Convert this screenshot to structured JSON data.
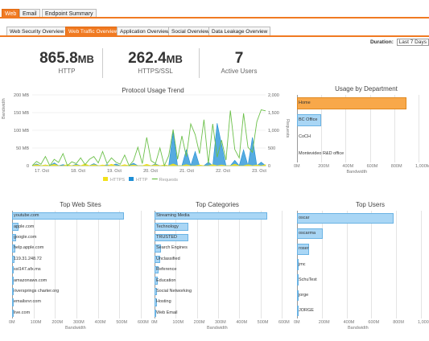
{
  "top_tabs": [
    {
      "label": "Web",
      "active": true
    },
    {
      "label": "Email",
      "active": false
    },
    {
      "label": "Endpoint Summary",
      "active": false
    }
  ],
  "sub_tabs": [
    {
      "label": "Web Security Overview",
      "active": false
    },
    {
      "label": "Web Traffic Overview",
      "active": true
    },
    {
      "label": "Application Overview",
      "active": false
    },
    {
      "label": "Social Overview",
      "active": false
    },
    {
      "label": "Data Leakage Overview",
      "active": false
    }
  ],
  "duration": {
    "label": "Duration:",
    "value": "Last 7 Days"
  },
  "stats": [
    {
      "value": "865.8",
      "unit": "MB",
      "label": "HTTP"
    },
    {
      "value": "262.4",
      "unit": "MB",
      "label": "HTTPS/SSL"
    },
    {
      "value": "7",
      "unit": "",
      "label": "Active Users"
    }
  ],
  "colors": {
    "accent": "#f07a22",
    "https": "#f2e11a",
    "http": "#1e8fd6",
    "requests": "#6cc04a",
    "bar": "#a9d6f5",
    "bar_border": "#6ab3e4",
    "highlight": "#f8a84a"
  },
  "chart_data": [
    {
      "type": "line",
      "title": "Protocol Usage Trend",
      "xlabel": "",
      "ylabel": "Bandwidth",
      "ylabel_right": "Requests",
      "categories": [
        "17. Oct",
        "18. Oct",
        "19. Oct",
        "20. Oct",
        "21. Oct",
        "22. Oct",
        "23. Oct"
      ],
      "ylim": [
        0,
        200
      ],
      "yticks": [
        "0",
        "50 MB",
        "100 MB",
        "150 MB",
        "200 MB"
      ],
      "ylim_right": [
        0,
        2000
      ],
      "yticks_right": [
        "0",
        "500",
        "1,000",
        "1,500",
        "2,000"
      ],
      "legend": [
        "HTTPS",
        "HTTP",
        "Requests"
      ],
      "legend_position": "bottom",
      "series": [
        {
          "name": "HTTPS",
          "values": [
            0,
            3,
            0,
            2,
            0,
            4,
            0,
            0,
            3,
            0,
            2,
            0,
            5,
            0,
            3,
            0,
            2,
            0,
            4,
            0,
            0,
            3,
            0,
            2,
            0,
            0,
            4,
            0,
            3,
            0,
            2,
            0,
            5,
            0,
            0,
            3,
            0,
            0,
            2,
            0,
            0,
            3,
            0,
            2,
            0,
            0,
            4,
            0,
            0,
            3,
            0,
            2,
            0,
            3
          ]
        },
        {
          "name": "HTTP",
          "values": [
            0,
            5,
            0,
            2,
            0,
            8,
            0,
            3,
            0,
            0,
            4,
            0,
            2,
            0,
            6,
            0,
            0,
            3,
            0,
            5,
            0,
            2,
            0,
            7,
            0,
            0,
            3,
            0,
            5,
            0,
            2,
            0,
            95,
            0,
            0,
            45,
            0,
            40,
            0,
            0,
            10,
            0,
            120,
            60,
            0,
            0,
            15,
            0,
            45,
            0,
            80,
            0,
            10,
            0
          ]
        },
        {
          "name": "Requests",
          "values": [
            0,
            120,
            40,
            260,
            0,
            180,
            90,
            340,
            0,
            110,
            60,
            220,
            30,
            180,
            260,
            80,
            400,
            60,
            220,
            100,
            40,
            300,
            0,
            140,
            520,
            60,
            800,
            140,
            60,
            500,
            0,
            280,
            1020,
            180,
            840,
            260,
            1180,
            880,
            340,
            1300,
            60,
            1180,
            240,
            720,
            160,
            1560,
            460,
            220,
            1480,
            520,
            380,
            1240,
            1580,
            1550
          ]
        }
      ]
    },
    {
      "type": "bar",
      "title": "Usage by Department",
      "orientation": "horizontal",
      "categories": [
        "Home",
        "BC Office",
        "CoCH",
        "Montevideo R&D office"
      ],
      "values": [
        900,
        200,
        0,
        0
      ],
      "xlabel": "Bandwidth",
      "xticks": [
        "0M",
        "200M",
        "400M",
        "600M",
        "800M",
        "1,000M"
      ],
      "xlim": [
        0,
        1000
      ]
    },
    {
      "type": "bar",
      "title": "Top Web Sites",
      "orientation": "horizontal",
      "categories": [
        "youtube.com",
        "apple.com",
        "google.com",
        "help.apple.com",
        "119.31.248.72",
        "ssl147.afx.ms",
        "amazonaws.com",
        "riversprings charter.org",
        "emailsrvr.com",
        "live.com"
      ],
      "values": [
        520,
        30,
        20,
        15,
        10,
        8,
        6,
        5,
        4,
        3
      ],
      "xlabel": "Bandwidth",
      "xticks": [
        "0M",
        "100M",
        "200M",
        "300M",
        "400M",
        "500M",
        "600M"
      ],
      "xlim": [
        0,
        600
      ]
    },
    {
      "type": "bar",
      "title": "Top Categories",
      "orientation": "horizontal",
      "categories": [
        "Streaming Media",
        "Technology",
        "TRUSTED",
        "Search Engines",
        "Unclassified",
        "Reference",
        "Education",
        "Social Networking",
        "Hosting",
        "Web Email"
      ],
      "values": [
        530,
        160,
        160,
        30,
        25,
        20,
        15,
        12,
        10,
        8
      ],
      "xlabel": "Bandwidth",
      "xticks": [
        "0M",
        "100M",
        "200M",
        "300M",
        "400M",
        "500M",
        "600M"
      ],
      "xlim": [
        0,
        600
      ]
    },
    {
      "type": "bar",
      "title": "Top Users",
      "orientation": "horizontal",
      "categories": [
        "oscar",
        "oscarma",
        "roser",
        "jmc",
        "SchuTest",
        "jorge",
        "JORGE"
      ],
      "values": [
        780,
        210,
        100,
        10,
        8,
        6,
        5
      ],
      "xlabel": "Bandwidth",
      "xticks": [
        "0M",
        "200M",
        "400M",
        "600M",
        "800M",
        "1,000M"
      ],
      "xlim": [
        0,
        1000
      ]
    }
  ]
}
